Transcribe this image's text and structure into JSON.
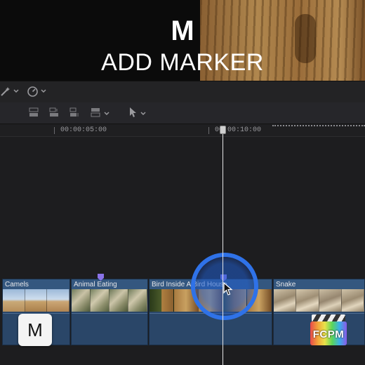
{
  "overlay": {
    "key_letter": "M",
    "caption": "ADD MARKER",
    "key_badge": "M"
  },
  "ruler": {
    "timecode_1": "00:00:05:00",
    "timecode_2": "00:00:10:00"
  },
  "clips": [
    {
      "label": "Camels"
    },
    {
      "label": "Animal Eating"
    },
    {
      "label": "Bird Inside A Bird House"
    },
    {
      "label": "Snake"
    }
  ],
  "logo": {
    "text": "FCPM"
  },
  "icons": {
    "toolbar1": [
      "magic-wand-icon",
      "chevron-down-icon",
      "speed-gauge-icon",
      "chevron-down-icon"
    ],
    "toolbar2": [
      "connect-clip-icon",
      "insert-clip-icon",
      "append-clip-icon",
      "overwrite-clip-icon",
      "chevron-down-icon",
      "select-arrow-icon",
      "chevron-down-icon"
    ],
    "cursor": "pointer-arrow-icon"
  },
  "colors": {
    "clip_blue": "#2d4d74",
    "marker_purple": "#8a73e8",
    "click_highlight": "#2f72e8",
    "playhead": "#e6e6e6"
  }
}
